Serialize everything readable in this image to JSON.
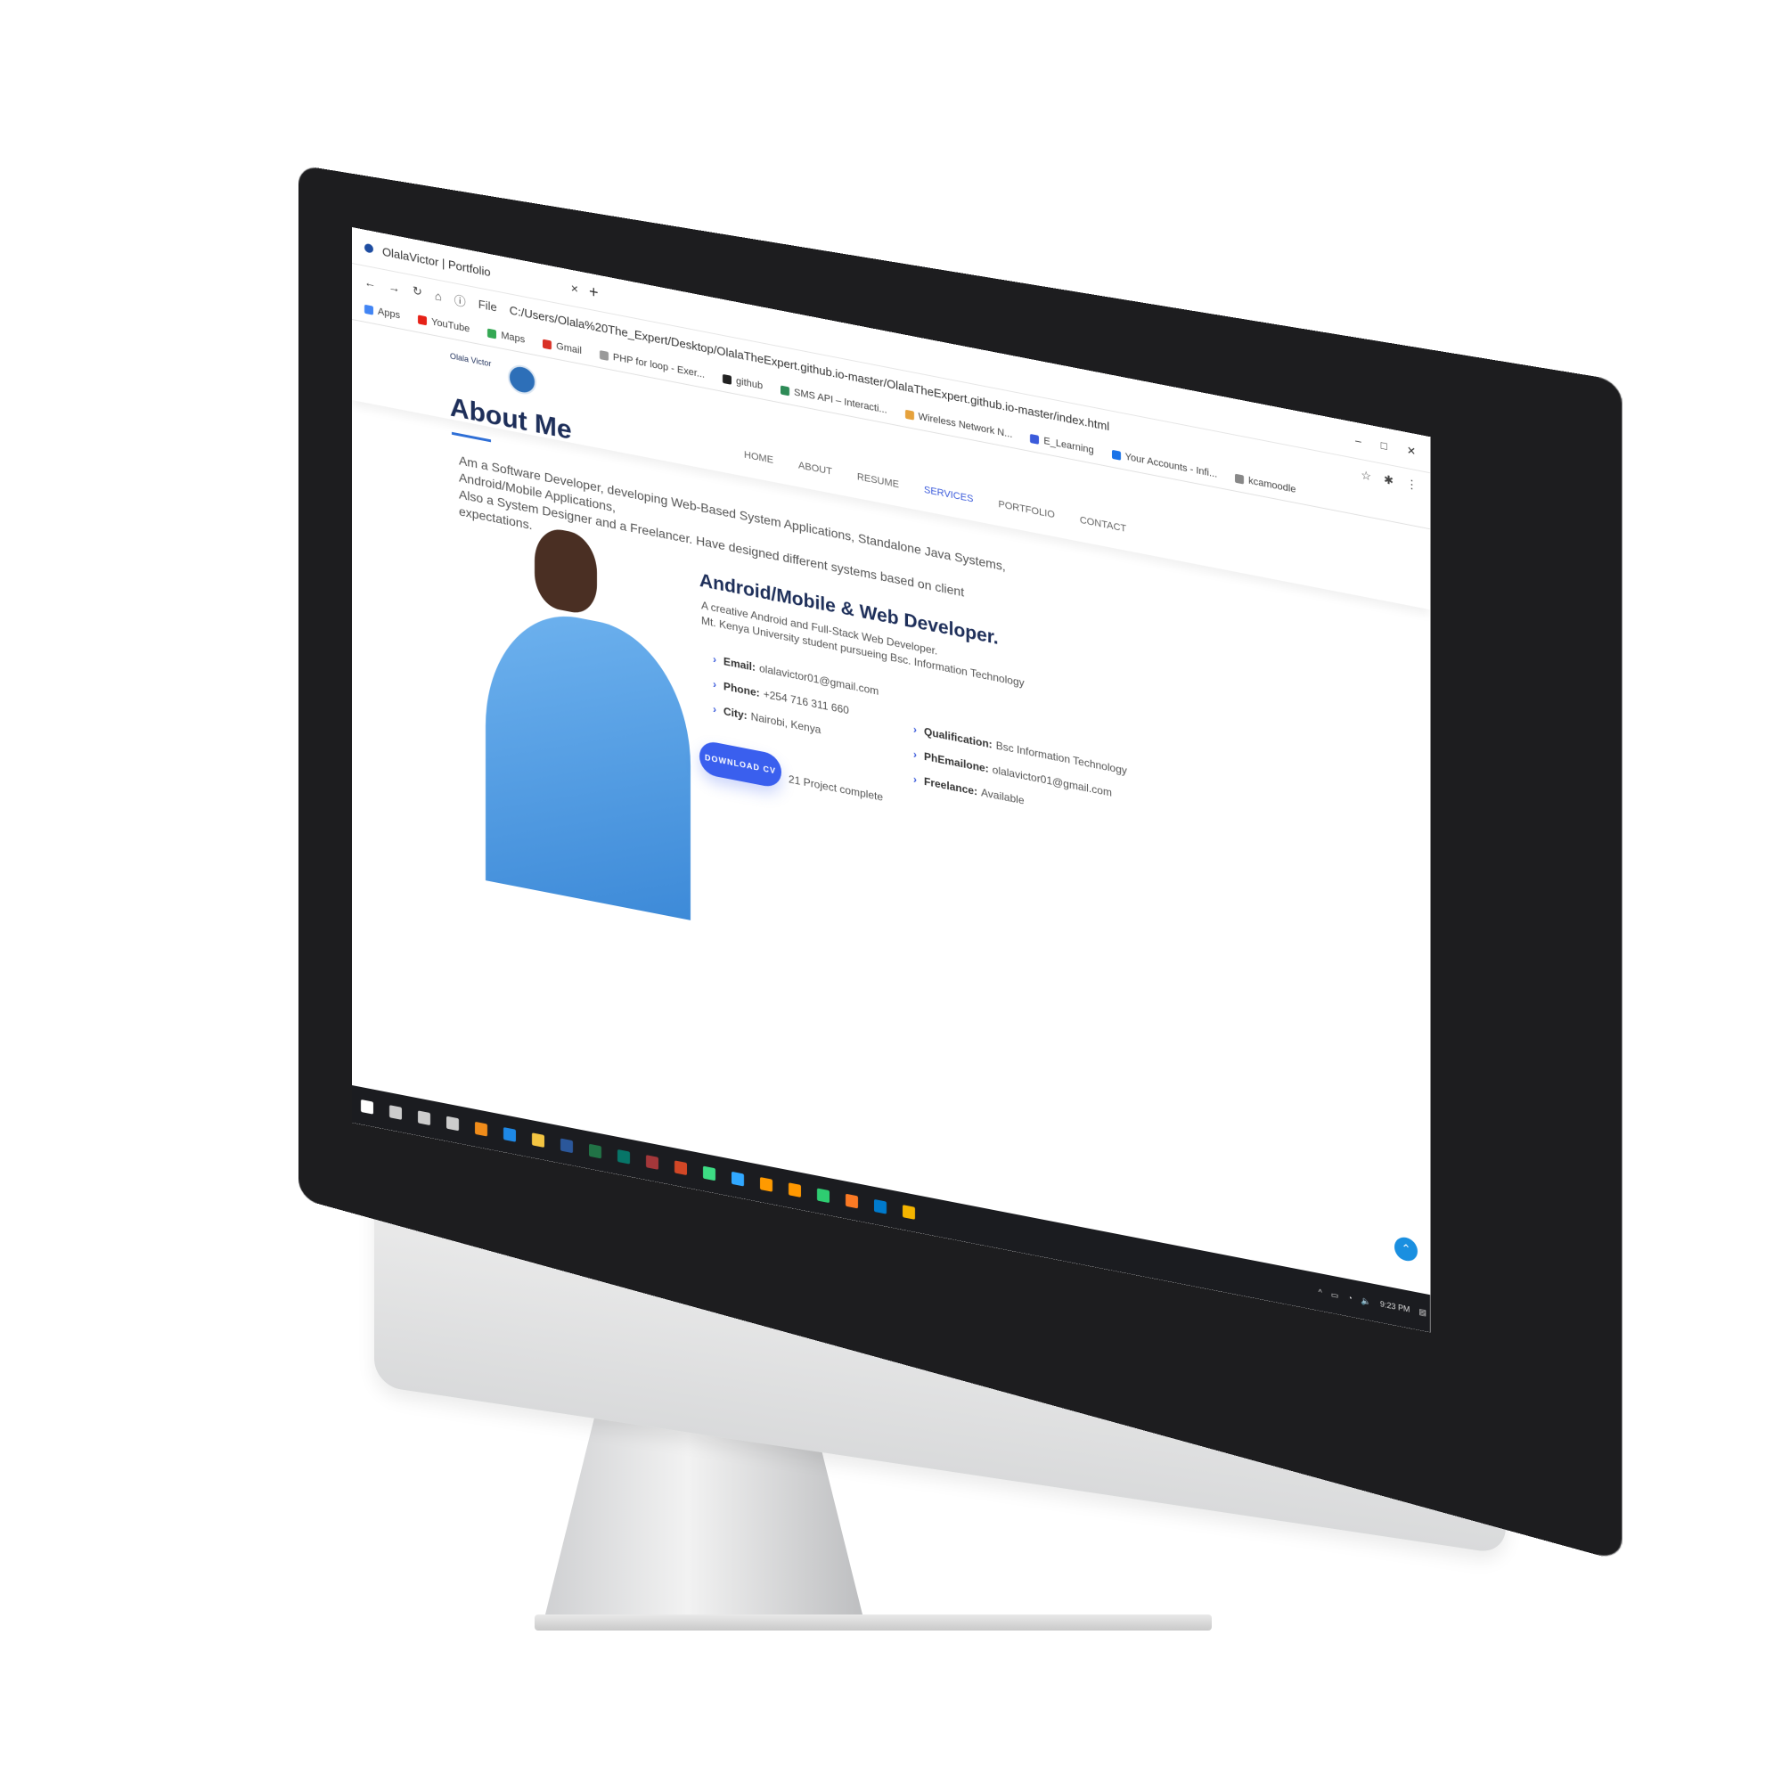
{
  "browser": {
    "tab_title": "OlalaVictor | Portfolio",
    "tab_close": "×",
    "new_tab": "+",
    "url_scheme": "File",
    "url": "C:/Users/Olala%20The_Expert/Desktop/OlalaTheExpert.github.io-master/OlalaTheExpert.github.io-master/index.html",
    "bookmarks": [
      {
        "label": "Apps",
        "icon": "apps-grid-icon",
        "color": "#4285f4"
      },
      {
        "label": "YouTube",
        "icon": "youtube-icon",
        "color": "#e62117"
      },
      {
        "label": "Maps",
        "icon": "maps-icon",
        "color": "#34a853"
      },
      {
        "label": "Gmail",
        "icon": "gmail-icon",
        "color": "#d93025"
      },
      {
        "label": "PHP for loop - Exer...",
        "icon": "php-icon",
        "color": "#999999"
      },
      {
        "label": "github",
        "icon": "github-icon",
        "color": "#222222"
      },
      {
        "label": "SMS API – Interacti...",
        "icon": "sms-api-icon",
        "color": "#2e8b57"
      },
      {
        "label": "Wireless Network N...",
        "icon": "wireless-icon",
        "color": "#e6a23c"
      },
      {
        "label": "E_Learning",
        "icon": "elearning-icon",
        "color": "#3b5bdb"
      },
      {
        "label": "Your Accounts - Infi...",
        "icon": "accounts-icon",
        "color": "#1a73e8"
      },
      {
        "label": "kcamoodle",
        "icon": "moodle-icon",
        "color": "#888888"
      }
    ]
  },
  "site": {
    "logo_text": "Olala Victor",
    "nav": [
      {
        "label": "HOME",
        "active": false
      },
      {
        "label": "ABOUT",
        "active": false
      },
      {
        "label": "RESUME",
        "active": false
      },
      {
        "label": "SERVICES",
        "active": true
      },
      {
        "label": "PORTFOLIO",
        "active": false
      },
      {
        "label": "CONTACT",
        "active": false
      }
    ],
    "section_title": "About Me",
    "intro_line1": "Am a Software Developer, developing Web-Based System Applications, Standalone Java Systems, Android/Mobile Applications,",
    "intro_line2": "Also a System Designer and a Freelancer. Have designed different systems based on client expectations.",
    "role_title": "Android/Mobile & Web Developer.",
    "role_line1": "A creative Android and Full-Stack Web Developer.",
    "role_line2": "Mt. Kenya University student pursueing Bsc. Information Technology",
    "info_left": [
      {
        "label": "Email:",
        "value": "olalavictor01@gmail.com"
      },
      {
        "label": "Phone:",
        "value": "+254 716 311 660"
      },
      {
        "label": "City:",
        "value": "Nairobi, Kenya"
      }
    ],
    "info_right": [
      {
        "label": "Qualification:",
        "value": "Bsc Information Technology"
      },
      {
        "label": "PhEmailone:",
        "value": "olalavictor01@gmail.com"
      },
      {
        "label": "Freelance:",
        "value": "Available"
      }
    ],
    "cv_button": "DOWNLOAD CV",
    "projects": "21 Project complete",
    "accent": "#3a5fee",
    "title_color": "#1e2f5a"
  },
  "taskbar": {
    "clock": "9:23 PM",
    "icons": [
      "windows-start-icon",
      "search-icon",
      "cortana-icon",
      "task-view-icon",
      "search-app-icon",
      "edge-icon",
      "file-explorer-icon",
      "word-icon",
      "excel-icon",
      "publisher-icon",
      "access-icon",
      "powerpoint-icon",
      "android-icon",
      "photoshop-icon",
      "illustrator-icon",
      "sublime-icon",
      "app-icon",
      "xampp-icon",
      "vscode-icon",
      "chrome-icon"
    ]
  }
}
